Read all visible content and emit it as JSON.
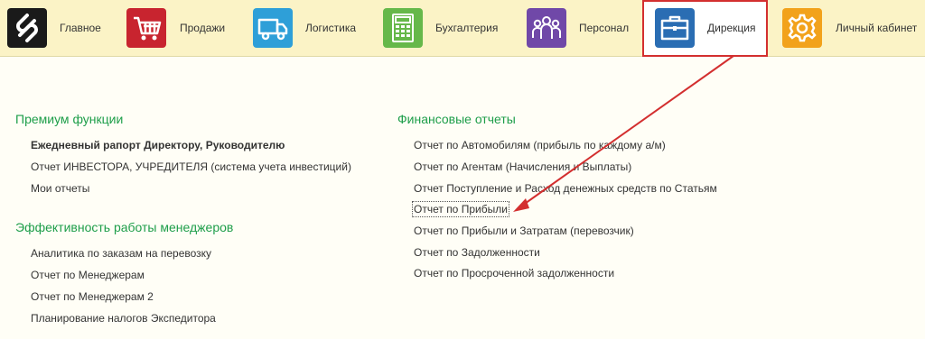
{
  "nav": {
    "main": "Главное",
    "sales": "Продажи",
    "logistics": "Логистика",
    "accounting": "Бухгалтерия",
    "staff": "Персонал",
    "directorate": "Дирекция",
    "account": "Личный кабинет"
  },
  "colors": {
    "logo": "#1a1a1a",
    "sales": "#c8242f",
    "logistics": "#2e9fd8",
    "accounting": "#66b84a",
    "staff": "#7048a8",
    "directorate": "#2a6db3",
    "account": "#f2a21b",
    "section_title": "#1e9e4a",
    "annotation": "#d32f2f"
  },
  "left": {
    "premium": {
      "title": "Премиум функции",
      "items": [
        "Ежедневный рапорт Директору, Руководителю",
        "Отчет ИНВЕСТОРА, УЧРЕДИТЕЛЯ (система учета инвестиций)",
        "Мои отчеты"
      ]
    },
    "efficiency": {
      "title": "Эффективность работы менеджеров",
      "items": [
        "Аналитика по заказам на перевозку",
        "Отчет по Менеджерам",
        "Отчет по Менеджерам 2",
        "Планирование налогов Экспедитора"
      ]
    }
  },
  "right": {
    "financial": {
      "title": "Финансовые отчеты",
      "items": [
        "Отчет по Автомобилям (прибыль по каждому а/м)",
        "Отчет по Агентам (Начисления и Выплаты)",
        "Отчет Поступление и Расход денежных средств по Статьям",
        "Отчет по Прибыли",
        "Отчет по Прибыли и Затратам (перевозчик)",
        "Отчет по Задолженности",
        "Отчет по Просроченной задолженности"
      ]
    }
  }
}
